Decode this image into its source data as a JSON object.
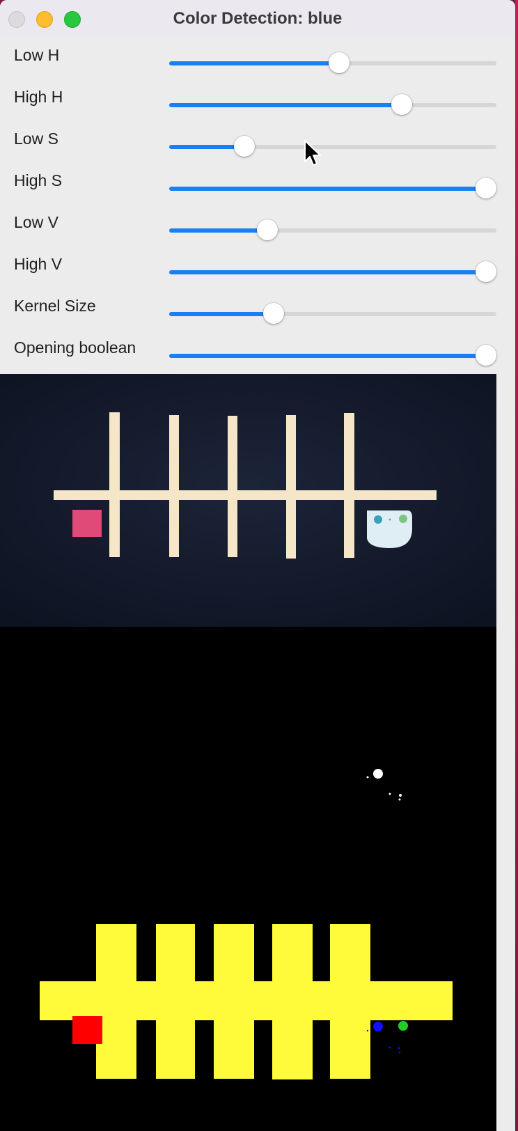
{
  "window": {
    "title": "Color Detection: blue"
  },
  "sliders": [
    {
      "label": "Low H",
      "value": 0.52
    },
    {
      "label": "High H",
      "value": 0.71
    },
    {
      "label": "Low S",
      "value": 0.23
    },
    {
      "label": "High S",
      "value": 1.0
    },
    {
      "label": "Low V",
      "value": 0.3
    },
    {
      "label": "High V",
      "value": 1.0
    },
    {
      "label": "Kernel Size",
      "value": 0.32
    },
    {
      "label": "Opening boolean",
      "value": 1.0
    }
  ],
  "colors": {
    "accent": "#1a7ff2",
    "track": "#d6d6d6",
    "camera_bg": "#141b2c",
    "mask_yellow": "#fffa3a",
    "mask_red": "#ff0000",
    "mask_blue": "#1010ff",
    "mask_green": "#20d020"
  },
  "icons": [
    "close-icon",
    "minimize-icon",
    "maximize-icon",
    "mouse-cursor-icon"
  ]
}
